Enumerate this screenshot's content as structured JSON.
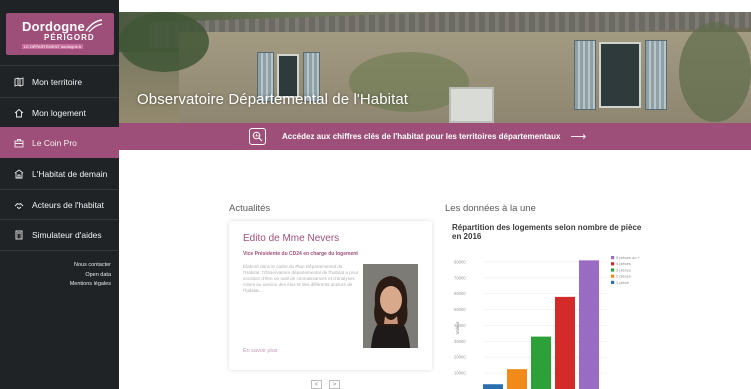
{
  "sidebar": {
    "logo": {
      "line1": "Dordogne",
      "line2": "PÉRIGORD",
      "line3": "LE DÉPARTEMENT dordogne.fr"
    },
    "items": [
      {
        "label": "Mon territoire",
        "icon": "map-icon"
      },
      {
        "label": "Mon logement",
        "icon": "home-icon"
      },
      {
        "label": "Le Coin Pro",
        "icon": "briefcase-icon"
      },
      {
        "label": "L'Habitat de demain",
        "icon": "building-icon"
      },
      {
        "label": "Acteurs de l'habitat",
        "icon": "handshake-icon"
      },
      {
        "label": "Simulateur d'aides",
        "icon": "calculator-icon"
      }
    ],
    "links": [
      "Nous contacter",
      "Open data",
      "Mentions légales"
    ]
  },
  "hero": {
    "title": "Observatoire Départemental de l'Habitat"
  },
  "banner": {
    "text": "Accédez aux chiffres clés de l'habitat pour les territoires départementaux",
    "arrow": "⟶"
  },
  "news": {
    "section_title": "Actualités",
    "card_title": "Edito de Mme Nevers",
    "card_subtitle": "Vice Présidente du CD24 en charge du logement",
    "card_text": "Élaboré dans le cadre du Plan Départemental de l'Habitat, l'Observatoire départemental de l'habitat a pour vocation d'être un outil de connaissances et d'analyses mises au service des élus et des différents acteurs de l'habitat...",
    "more_link": "En savoir plus",
    "pager_prev": "<",
    "pager_next": ">"
  },
  "data_section": {
    "section_title": "Les données à la une"
  },
  "chart_data": {
    "type": "bar",
    "title": "Répartition des logements selon nombre de pièce en  2016",
    "ylabel": "Valeur",
    "ylim": [
      0,
      85000
    ],
    "yticks": [
      10000,
      20000,
      30000,
      40000,
      50000,
      60000,
      70000,
      80000
    ],
    "series": [
      {
        "name": "1 pièce",
        "value": 3000,
        "color": "#2a6fb0"
      },
      {
        "name": "2 pièces",
        "value": 12500,
        "color": "#f28a1a"
      },
      {
        "name": "3 pièces",
        "value": 33000,
        "color": "#2ea03a"
      },
      {
        "name": "4 pièces",
        "value": 58000,
        "color": "#d42a2a"
      },
      {
        "name": "5 pièces ou +",
        "value": 81000,
        "color": "#9a6bc2"
      }
    ],
    "legend_position": "top-right",
    "grid": true
  }
}
